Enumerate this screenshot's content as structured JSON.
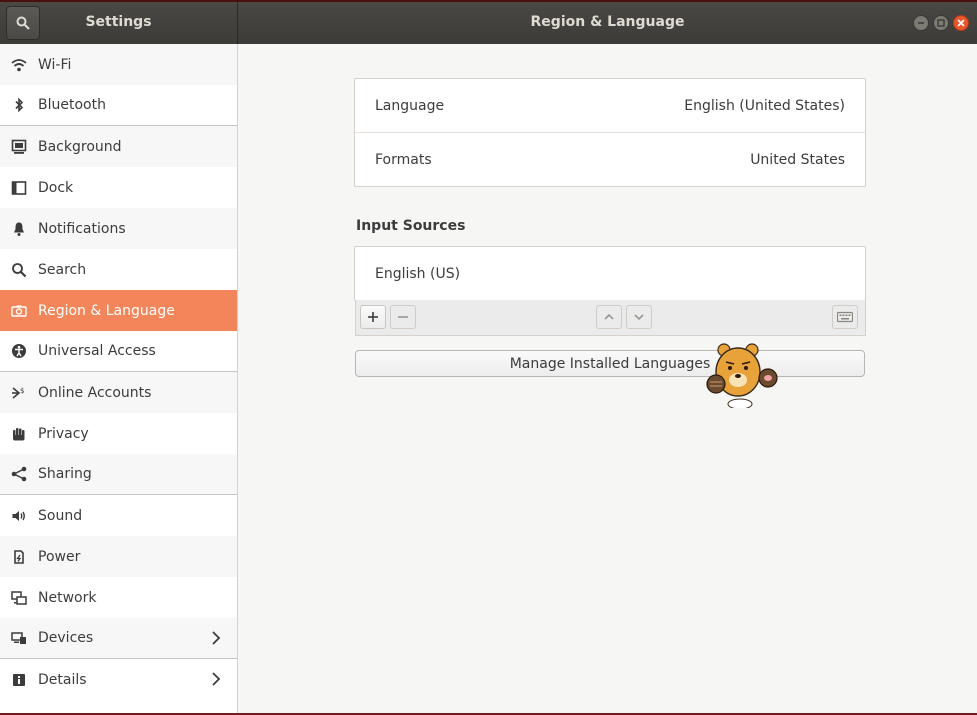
{
  "header": {
    "left_title": "Settings",
    "title": "Region & Language",
    "search_icon": "search-icon",
    "window_buttons": [
      "minimize",
      "maximize",
      "close"
    ]
  },
  "sidebar": {
    "items": [
      {
        "label": "Wi-Fi",
        "icon": "wifi-icon"
      },
      {
        "label": "Bluetooth",
        "icon": "bluetooth-icon"
      },
      {
        "label": "Background",
        "icon": "background-icon"
      },
      {
        "label": "Dock",
        "icon": "dock-icon"
      },
      {
        "label": "Notifications",
        "icon": "bell-icon"
      },
      {
        "label": "Search",
        "icon": "search-icon"
      },
      {
        "label": "Region & Language",
        "icon": "camera-icon",
        "active": true
      },
      {
        "label": "Universal Access",
        "icon": "accessibility-icon"
      },
      {
        "label": "Online Accounts",
        "icon": "online-accounts-icon"
      },
      {
        "label": "Privacy",
        "icon": "hand-icon"
      },
      {
        "label": "Sharing",
        "icon": "share-icon"
      },
      {
        "label": "Sound",
        "icon": "speaker-icon"
      },
      {
        "label": "Power",
        "icon": "power-icon"
      },
      {
        "label": "Network",
        "icon": "network-icon"
      },
      {
        "label": "Devices",
        "icon": "devices-icon",
        "chevron": true
      },
      {
        "label": "Details",
        "icon": "info-icon",
        "chevron": true
      }
    ]
  },
  "main": {
    "language_label": "Language",
    "language_value": "English (United States)",
    "formats_label": "Formats",
    "formats_value": "United States",
    "input_sources_title": "Input Sources",
    "input_sources": [
      "English (US)"
    ],
    "toolbar": {
      "add_label": "+",
      "remove_label": "−"
    },
    "manage_button": "Manage Installed Languages"
  },
  "colors": {
    "accent": "#f2855a",
    "header": "#3c3b37",
    "close": "#e9552c"
  }
}
